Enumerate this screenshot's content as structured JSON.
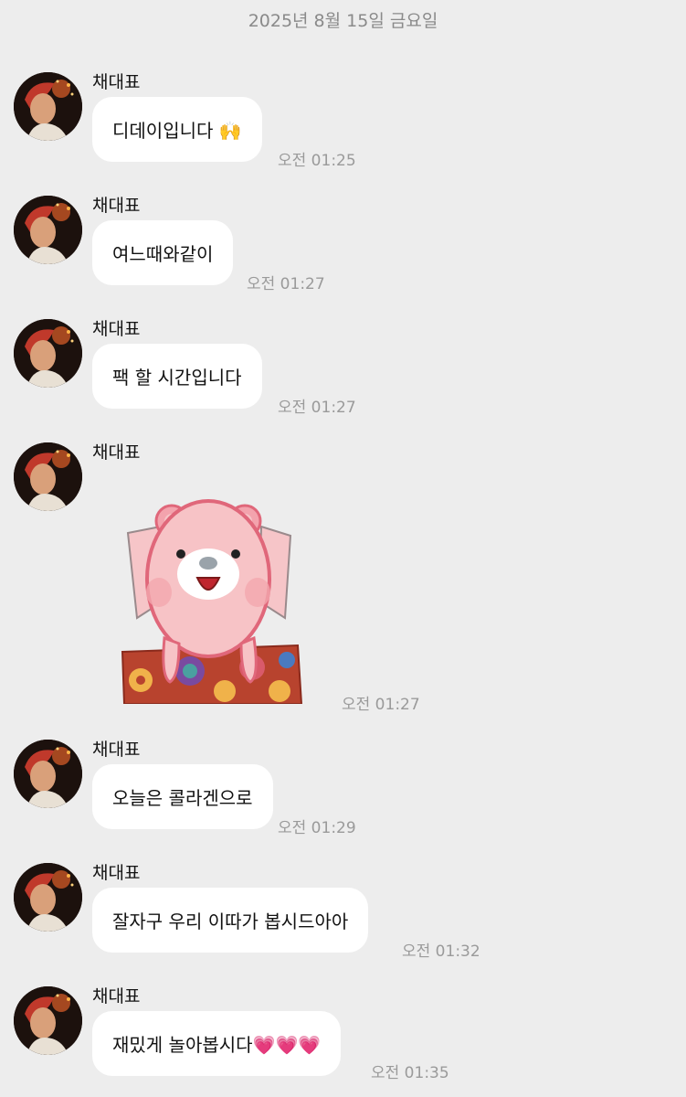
{
  "date_header": "2025년 8월 15일 금요일",
  "colors": {
    "background": "#ededed",
    "bubble": "#ffffff",
    "time": "#9a9a9a"
  },
  "messages": [
    {
      "sender": "채대표",
      "text": "디데이입니다 🙌",
      "time": "오전 01:25",
      "type": "text"
    },
    {
      "sender": "채대표",
      "text": "여느때와같이",
      "time": "오전 01:27",
      "type": "text"
    },
    {
      "sender": "채대표",
      "text": "팩 할 시간입니다",
      "time": "오전 01:27",
      "type": "text"
    },
    {
      "sender": "채대표",
      "sticker": "pink-bear-sticker",
      "time": "오전 01:27",
      "type": "sticker"
    },
    {
      "sender": "채대표",
      "text": "오늘은 콜라겐으로",
      "time": "오전 01:29",
      "type": "text"
    },
    {
      "sender": "채대표",
      "text": "잘자구 우리 이따가 봅시드아아",
      "time": "오전 01:32",
      "type": "text"
    },
    {
      "sender": "채대표",
      "text": "재밌게 놀아봅시다💗💗💗",
      "time": "오전 01:35",
      "type": "text"
    }
  ]
}
